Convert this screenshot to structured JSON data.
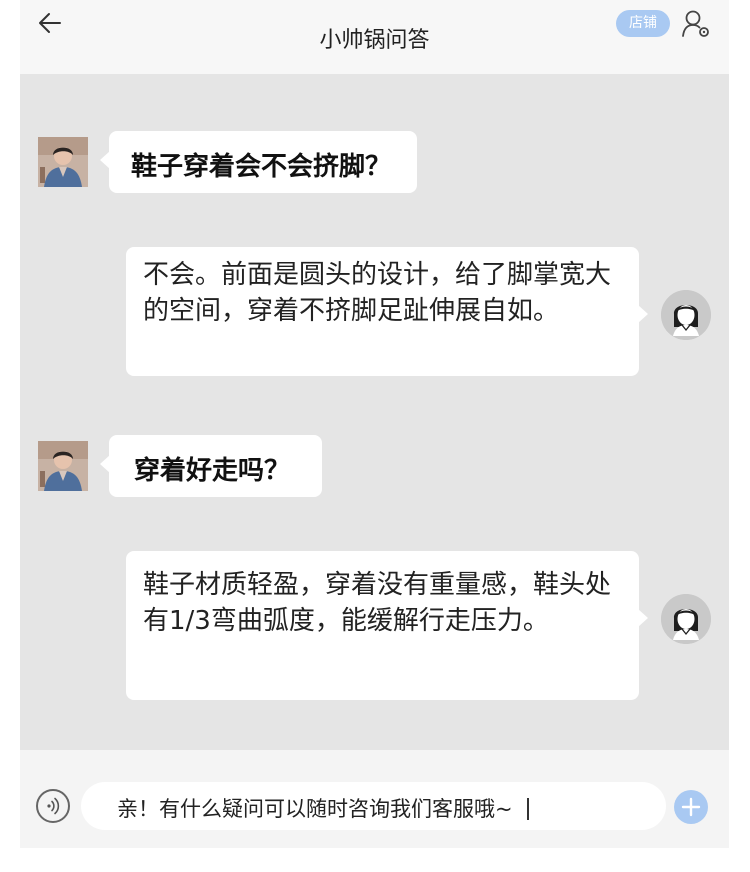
{
  "header": {
    "title": "小帅锅问答",
    "shop_label": "店铺"
  },
  "messages": [
    {
      "role": "customer",
      "text": "鞋子穿着会不会挤脚？"
    },
    {
      "role": "agent",
      "text": "不会。前面是圆头的设计，给了脚掌宽大的空间，穿着不挤脚足趾伸展自如。"
    },
    {
      "role": "customer",
      "text": "穿着好走吗？"
    },
    {
      "role": "agent",
      "text": "鞋子材质轻盈，穿着没有重量感，鞋头处有1/3弯曲弧度，能缓解行走压力。"
    }
  ],
  "input": {
    "value": "亲！有什么疑问可以随时咨询我们客服哦~"
  },
  "colors": {
    "accent": "#a9c9f2",
    "chat_background": "#e5e5e5",
    "header_background": "#f7f7f7",
    "bubble": "#ffffff"
  },
  "icons": [
    "back-arrow-icon",
    "user-settings-icon",
    "voice-icon",
    "plus-icon"
  ]
}
